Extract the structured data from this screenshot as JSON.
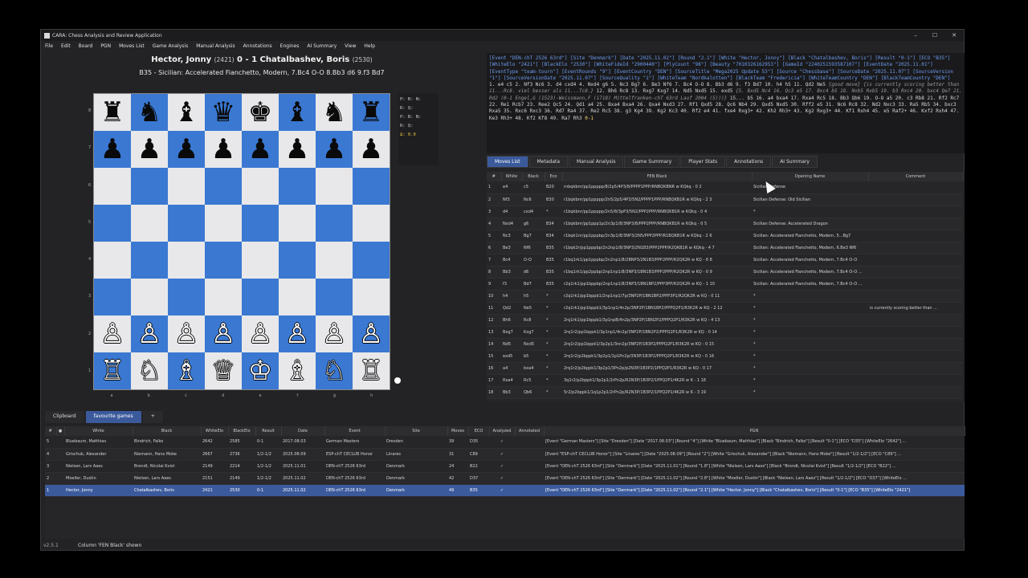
{
  "app": {
    "title": "CARA: Chess Analysis and Review Application",
    "version": "v2.5.1",
    "status": "Column 'FEN Black' shown"
  },
  "window_controls": [
    "–",
    "☐",
    "✕"
  ],
  "menu": [
    "File",
    "Edit",
    "Board",
    "PGN",
    "Moves List",
    "Game Analysis",
    "Manual Analysis",
    "Annotations",
    "Engines",
    "AI Summary",
    "View",
    "Help"
  ],
  "header": {
    "white": "Hector, Jonny",
    "white_elo": "(2421)",
    "result": "0 - 1",
    "black": "Chatalbashev, Boris",
    "black_elo": "(2530)",
    "opening": "B35 - Sicilian: Accelerated Fianchetto, Modern, 7.Bc4 O-O 8.Bb3 d6 9.f3 Bd7"
  },
  "board": {
    "ranks": [
      "8",
      "7",
      "6",
      "5",
      "4",
      "3",
      "2",
      "1"
    ],
    "files": [
      "a",
      "b",
      "c",
      "d",
      "e",
      "f",
      "g",
      "h"
    ],
    "rows": [
      [
        "♜",
        "♞",
        "♝",
        "♛",
        "♚",
        "♝",
        "♞",
        "♜"
      ],
      [
        "♟",
        "♟",
        "♟",
        "♟",
        "♟",
        "♟",
        "♟",
        "♟"
      ],
      [
        "",
        "",
        "",
        "",
        "",
        "",
        "",
        ""
      ],
      [
        "",
        "",
        "",
        "",
        "",
        "",
        "",
        ""
      ],
      [
        "",
        "",
        "",
        "",
        "",
        "",
        "",
        ""
      ],
      [
        "",
        "",
        "",
        "",
        "",
        "",
        "",
        ""
      ],
      [
        "♙",
        "♙",
        "♙",
        "♙",
        "♙",
        "♙",
        "♙",
        "♙"
      ],
      [
        "♖",
        "♘",
        "♗",
        "♕",
        "♔",
        "♗",
        "♘",
        "♖"
      ]
    ]
  },
  "material": {
    "lines": [
      "P: B: N:",
      "R: Q:",
      "P: B: N:",
      "R: Q:"
    ],
    "delta": "Δ: 0.0"
  },
  "pgn": {
    "headers": "[Event \"DEN-chT 2526 63rd\"] [Site \"Denmark\"] [Date \"2025.11.02\"] [Round \"2.1\"] [White \"Hector, Jonny\"] [Black \"Chatalbashev, Boris\"] [Result \"0-1\"] [ECO \"B35\"] [WhiteElo \"2421\"] [BlackElo \"2530\"] [WhiteFideId \"2900440\"] [PlyCount \"98\"] [Beauty \"7010326162953\"] [GameId \"2240251593587107\"] [EventDate \"2025.11.01\"] [EventType \"team-tourn\"] [EventRounds \"9\"] [EventCountry \"DEN\"] [SourceTitle \"Mega2025 Update 53\"] [Source \"Chessbase\"] [SourceDate \"2025.11.07\"] [SourceVersion \"1\"] [SourceVersionDate \"2025.11.07\"] [SourceQuality \"1\"] [WhiteTeam \"Nordkalotten\"] [BlackTeam \"Fredericia\"] [WhiteTeamCountry \"DEN\"] [BlackTeamCountry \"DEN\"]",
    "moves1": "1. e4 c5 2. Nf3 Nc6 3. d4 cxd4 4. Nxd4 g6 5. Nc3 Bg7 6. Be3 Nf6 7. Bc4 O-O 8. Bb3 d6 9. f3 Bd7 10. h4 h5 11. Qd2 Ne5",
    "comment1": " {good move} {is currently scoring better than 11...Rc8. viel besser als 11...Tc8.} ",
    "moves2": "12. Bh6 Rc8 13. Rxg7 Kxg7 14. Nd5 Nxd5 15. exd5",
    "comment2": " {5. Bxd5 Nc4 16. Qc3 e5 17. Bxc4 b5 18. Nxb5 Rxb5 19. b3 Rxc4 20. bxc4 Qe7 21. Rd2 (0-1 Engel,G (1523)-Weissmann,F (1718) Mittelfranken-chT 63rd Lauf 2004 (5)))} ",
    "moves3": "15... b5 16. a4 bxa4 17. Rxa4 Rc5 18. Bb3 Qb6 19. O-O a5 20. c3 Rb8 21. Rf2 Rc7 22. Re1 Rcb7 23. Ree2 Qc5 24. Qd1 a4 25. Bxa4 Bxa4 26. Qxa4 Nxd3 27. Rf1 Qxd5 28. Qc6 Nb4 29. Qxd5 Nxd5 30. Rff2 e5 31. Nc6 Rc8 32. Nd2 Nxc3 33. Ra5 Rb5 34. bxc3 Rxa5 35. Rxc6 Rxc3 36. Rd7 Ra4 37. Re2 Rc5 38. g3 Kg4 39. Kg2 Kc3 40. Rf2 e4 41. fxe4 Rxg3+ 42. Kh2 Rh3+ 43. Kg2 Rxg3+ 44. Kf1 Rxh4 45. e5 Raf2+ 46. Kxf2 Rxh4 47. Ke3 Rh3+ 48. Kf2 Kf8 49. Ra7 Rh3",
    "result": " 0-1"
  },
  "tabs": [
    "Moves List",
    "Metadata",
    "Manual Analysis",
    "Game Summary",
    "Player Stats",
    "Annotations",
    "AI Summary"
  ],
  "moves_table": {
    "columns": [
      "#",
      "White",
      "Black",
      "Eco",
      "FEN Black",
      "Opening Name",
      "Comment"
    ],
    "rows": [
      [
        "1",
        "e4",
        "c5",
        "B20",
        "rnbqkbnr/pp1ppppp/8/2p5/4P3/8/PPPP1PPP/RNBQKBNR w KQkq - 0 2",
        "Sicilian Defense",
        ""
      ],
      [
        "2",
        "Nf3",
        "Nc6",
        "B30",
        "r1bqkbnr/pp1ppppp/2n5/2p5/4P3/5N2/PPPP1PPP/RNBQKB1R w KQkq - 2 3",
        "Sicilian Defense: Old Sicilian",
        ""
      ],
      [
        "3",
        "d4",
        "cxd4",
        "*",
        "r1bqkbnr/pp1ppppp/2n5/8/3pP3/5N2/PPP2PPP/RNBQKB1R w KQkq - 0 4",
        "*",
        ""
      ],
      [
        "4",
        "Nxd4",
        "g6",
        "B34",
        "r1bqkbnr/pp1ppp1p/2n3p1/8/3NP3/8/PPP2PPP/RNBQKB1R w KQkq - 0 5",
        "Sicilian Defense: Accelerated Dragon",
        ""
      ],
      [
        "5",
        "Nc3",
        "Bg7",
        "B34",
        "r1bqk1nr/pp1pppbp/2n3p1/8/3NP3/2N5/PPP2PPP/R1BQKB1R w KQkq - 2 6",
        "Sicilian: Accelerated Fianchetto, Modern, 5...Bg7",
        ""
      ],
      [
        "6",
        "Be3",
        "Nf6",
        "B35",
        "r1bqk2r/pp1pppbp/2n2np1/8/3NP3/2N1B3/PPP2PPP/R2QKB1R w KQkq - 4 7",
        "Sicilian: Accelerated Fianchetto, Modern, 6.Be3 Nf6",
        ""
      ],
      [
        "7",
        "Bc4",
        "O-O",
        "B35",
        "r1bq1rk1/pp1pppbp/2n2np1/8/2BNP3/2N1B3/PPP2PPP/R2QK2R w KQ - 6 8",
        "Sicilian: Accelerated Fianchetto, Modern, 7.Bc4 O-O",
        ""
      ],
      [
        "8",
        "Bb3",
        "d6",
        "B35",
        "r1bq1rk1/pp2ppbp/2np1np1/8/3NP3/1BN1B3/PPP2PPP/R2QK2R w KQ - 0 9",
        "Sicilian: Accelerated Fianchetto, Modern, 7.Bc4 O-O ...",
        ""
      ],
      [
        "9",
        "f3",
        "Bd7",
        "B35",
        "r2q1rk1/pp1bppbp/2np1np1/8/3NP3/1BN1BP2/PPP3PP/R2QK2R w KQ - 1 10",
        "Sicilian: Accelerated Fianchetto, Modern, 7.Bc4 O-O ...",
        ""
      ],
      [
        "10",
        "h4",
        "h5",
        "*",
        "r2q1rk1/pp1bppb1/2np1np1/7p/3NP2P/1BN1BP2/PPP3P1/R2QK2R w KQ - 0 11",
        "*",
        ""
      ],
      [
        "11",
        "Qd2",
        "Ne5",
        "*",
        "r2q1rk1/pp1bppb1/3p1np1/4n2p/3NP2P/1BN1BP2/PPPQ2P1/R3K2R w KQ - 2 12",
        "*",
        "is currently scoring better than ..."
      ],
      [
        "12",
        "Bh6",
        "Rc8",
        "*",
        "2rq1rk1/pp1bppb1/3p1npB/4n2p/3NP2P/1BN2P2/PPPQ2P1/R3K2R w KQ - 4 13",
        "*",
        ""
      ],
      [
        "13",
        "Bxg7",
        "Kxg7",
        "*",
        "2rq1r2/pp1bppk1/3p1np1/4n2p/3NP2P/1BN2P2/PPPQ2P1/R3K2R w KQ - 0 14",
        "*",
        ""
      ],
      [
        "14",
        "Nd5",
        "Nxd5",
        "*",
        "2rq1r2/pp1bppk1/3p2p1/3nn2p/3NP2P/1B3P2/PPPQ2P1/R3K2R w KQ - 0 15",
        "*",
        ""
      ],
      [
        "15",
        "exd5",
        "b5",
        "*",
        "2rq1r2/p2bppk1/3p2p1/1p1Pn2p/3N3P/1B3P2/PPPQ2P1/R3K2R w KQ - 0 16",
        "*",
        ""
      ],
      [
        "16",
        "a4",
        "bxa4",
        "*",
        "2rq1r2/p2bppk1/3p2p1/3Pn2p/p2N3P/1B3P2/1PPQ2P1/R3K2R w KQ - 0 17",
        "*",
        ""
      ],
      [
        "17",
        "Rxa4",
        "Rc5",
        "*",
        "3q1r2/p2bppk1/3p2p1/2rPn2p/R2N3P/1B3P2/1PPQ2P1/4K2R w K - 1 18",
        "*",
        ""
      ],
      [
        "18",
        "Bb3",
        "Qb6",
        "*",
        "5r2/p2bppk1/1q1p2p1/2rPn2p/R2N3P/1B3P2/1PPQ2P1/4K2R w K - 3 19",
        "*",
        ""
      ]
    ]
  },
  "bottom_tabs": [
    "Clipboard",
    "favourite games",
    "+"
  ],
  "db_table": {
    "columns": [
      "#",
      "●",
      "White",
      "Black",
      "WhiteElo",
      "BlackElo",
      "Result",
      "Date",
      "Event",
      "Site",
      "Moves",
      "ECO",
      "Analyzed",
      "Annotated",
      "PGN"
    ],
    "rows": [
      [
        "5",
        "",
        "Bluebaum, Matthias",
        "Bindrich, Falko",
        "2642",
        "2585",
        "0-1",
        "2017.08.03",
        "German Masters",
        "Dresden",
        "39",
        "D35",
        "✓",
        "",
        "[Event \"German Masters\"] [Site \"Dresden\"] [Date \"2017.08.03\"] [Round \"4\"] [White \"Bluebaum, Matthias\"] [Black \"Bindrich, Falko\"] [Result \"0-1\"] [ECO \"D35\"] [WhiteElo \"2642\"] ..."
      ],
      [
        "4",
        "",
        "Grischuk, Alexander",
        "Niemann, Hans Moke",
        "2667",
        "2736",
        "1/2-1/2",
        "2025.08.09",
        "ESP-chT CECLUB Honor",
        "Linares",
        "31",
        "C89",
        "✓",
        "",
        "[Event \"ESP-chT CECLUB Honor\"] [Site \"Linares\"] [Date \"2025.08.09\"] [Round \"2\"] [White \"Grischuk, Alexander\"] [Black \"Niemann, Hans Moke\"] [Result \"1/2-1/2\"] [ECO \"C89\"] ..."
      ],
      [
        "3",
        "",
        "Nielsen, Lars Aaes",
        "Brondt, Nicolai Kvist",
        "2149",
        "2214",
        "1/2-1/2",
        "2025.11.01",
        "DEN-chT 2526 63rd",
        "Denmark",
        "24",
        "B22",
        "✓",
        "",
        "[Event \"DEN-chT 2526 63rd\"] [Site \"Denmark\"] [Date \"2025.11.01\"] [Round \"1.8\"] [White \"Nielsen, Lars Aaes\"] [Black \"Brondt, Nicolai Kvist\"] [Result \"1/2-1/2\"] [ECO \"B22\"] ..."
      ],
      [
        "2",
        "",
        "Moeller, Dustin",
        "Nielsen, Lars Aaes",
        "2151",
        "2149",
        "1/2-1/2",
        "2025.11.02",
        "DEN-chT 2526 63rd",
        "Denmark",
        "42",
        "D37",
        "✓",
        "",
        "[Event \"DEN-chT 2526 63rd\"] [Site \"Denmark\"] [Date \"2025.11.02\"] [Round \"2.8\"] [White \"Moeller, Dustin\"] [Black \"Nielsen, Lars Aaes\"] [Result \"1/2-1/2\"] [ECO \"D37\"] [WhiteElo ..."
      ],
      [
        "1",
        "",
        "Hector, Jonny",
        "Chatalbashev, Boris",
        "2421",
        "2530",
        "0-1",
        "2025.11.02",
        "DEN-chT 2526 63rd",
        "Denmark",
        "49",
        "B35",
        "✓",
        "",
        "[Event \"DEN-chT 2526 63rd\"] [Site \"Denmark\"] [Date \"2025.11.02\"] [Round \"2.1\"] [White \"Hector, Jonny\"] [Black \"Chatalbashev, Boris\"] [Result \"0-1\"] [ECO \"B35\"] [WhiteElo \"2421\"]"
      ]
    ],
    "selected_index": 4
  },
  "colors": {
    "accent": "#3b5a9c",
    "dark_square": "#3a78d2",
    "light_square": "#e8e8ea",
    "pgn_header": "#6d9cf0"
  }
}
